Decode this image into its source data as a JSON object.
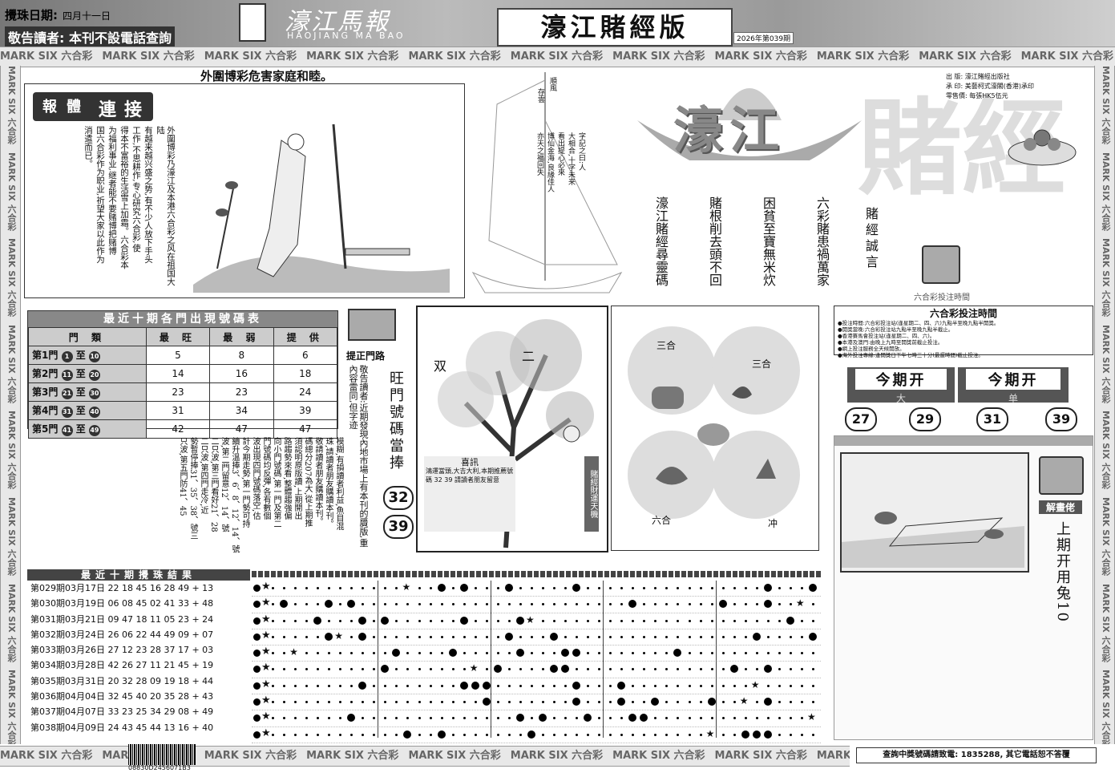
{
  "header": {
    "date_label": "攪珠日期:",
    "date_value": "四月十一日",
    "notice": "敬告讀者: 本刊不設電話查詢",
    "logo_cn": "濠江馬報",
    "logo_en": "HAOJIANG MA BAO",
    "edition": "濠江賭經版",
    "issue": "2026年第039期"
  },
  "band_text": "MARK SIX 六合彩",
  "left_article": {
    "banner": "外圍博彩危害家庭和睦。",
    "tags": [
      "報",
      "體",
      "連",
      "接"
    ],
    "columns": [
      "外圍博彩乃濠江及本港六合彩之风在祖国大陆",
      "有越来越兴盛之势,有不少人放下手头",
      "工作,不思耕作,专心研究六合彩,使",
      "得本不富裕的生活雪上加霜。六合彩本",
      "为福利事业,继者能不要赌博把赌博",
      "国六合彩作为职业,祈望大家以此作为",
      "消遣而已。"
    ]
  },
  "ship": {
    "sail_left": "順風",
    "sail_right": "存雲",
    "poem": [
      "字記之曰:人",
      "大相合,十字未来",
      "看出提心必來",
      "博仙金海,良緣佳人",
      "亦天之福回失"
    ]
  },
  "gamble_title": {
    "big1": "濠江",
    "big2": "賭經",
    "vertical_label": "賭經誠言",
    "verses": [
      "六彩賭患禍萬家",
      "困貧至寶無米炊",
      "賭根削去頭不回",
      "濠江賭經尋靈碼"
    ]
  },
  "publisher": {
    "lines": [
      "出 版: 濠江賭經出版社",
      "承 印: 美藝柯式濠閣(香港)承印",
      "零售價: 每張HK5伍元"
    ]
  },
  "door_table": {
    "title": "最近十期各門出現號碼表",
    "headers": [
      "門 類",
      "最 旺",
      "最 弱",
      "提 供"
    ],
    "rows": [
      {
        "label": "第1門",
        "from": "1",
        "to": "10",
        "max": "5",
        "min": "8",
        "offer": "6"
      },
      {
        "label": "第2門",
        "from": "11",
        "to": "20",
        "max": "14",
        "min": "16",
        "offer": "18"
      },
      {
        "label": "第3門",
        "from": "21",
        "to": "30",
        "max": "23",
        "min": "23",
        "offer": "24"
      },
      {
        "label": "第4門",
        "from": "31",
        "to": "40",
        "max": "31",
        "min": "34",
        "offer": "39"
      },
      {
        "label": "第5門",
        "from": "41",
        "to": "49",
        "max": "42",
        "min": "47",
        "offer": "47"
      }
    ],
    "to_word": "至"
  },
  "door_side": {
    "icon_label": "提正門路",
    "notice": "敬告讀者:近期發現內地市場上有本刊的贗版,重內容雷同,但字迹"
  },
  "door_text": {
    "cols": [
      "模糊,有損讀者利益,魚目混",
      "珠,請讀者朋友購讀本刊。",
      "敬請讀者朋友購讀本刊。",
      "碼總分207為大,從上期推",
      "須認明原版讀,上期開出",
      "路趨勢來看,整體趨強偏",
      "向小門號碼,第一門及第二",
      "門號碼均反彈,各有數個",
      "波出現四門號碼落空,估",
      "計今期走勢,第一門勢可持",
      "續升溫捧3、6、8、12、14、號",
      "波,第二門留意12、14、號",
      "二只波,第三門看好21、28",
      "二只波,第四門走冷,近",
      "勢暫停捧31、35、38、號三",
      "只波,第五門防41、45"
    ]
  },
  "tree": {
    "labels": [
      "二",
      "双"
    ],
    "box_title": "喜訊",
    "box_text": "鴻運當頭,大吉大利,本期推薦號碼 32 39 請讀者朋友留意",
    "side_tag": "賭經財運天機"
  },
  "wang": {
    "title": "旺門號碼當捧",
    "numbers": [
      "32",
      "39"
    ]
  },
  "zodiac": {
    "labels": [
      "三合",
      "三合",
      "六合",
      "冲"
    ]
  },
  "betting": {
    "icon_caption": "六合彩投注時間",
    "title": "六合彩投注時間",
    "lines": [
      "●投注時間:六合彩投注站(逢星期二、四、六)九點半至晚九點半開獎。",
      "●開獎當晚:六合彩投注站九點半至晚九點半截止。",
      "●香港賽馬會投注站(逢星期二、四、六)。",
      "●本港及澳門:由晚上九時至開獎前截止投注。",
      "●網上投注服務全天候開放。",
      "●海外投注專線:逢開獎日下午七時三十分(最遲時間)截止投注。"
    ],
    "open1": "今期开",
    "open1_val": "大",
    "open2": "今期开",
    "open2_val": "单",
    "balls": [
      "27",
      "29",
      "31",
      "39"
    ]
  },
  "riddle": {
    "label": "解畫佬",
    "text": "上期开用兔10"
  },
  "results": {
    "title": "最近十期攪珠結果",
    "rows": [
      "第029期03月17日 22 18 45 16 28 49 + 13",
      "第030期03月19日 06 08 45 02 41 33 + 48",
      "第031期03月21日 09 47 18 11 05 23 + 24",
      "第032期03月24日 26 06 22 44 49 09 + 07",
      "第033期03月26日 27 12 23 28 37 17 + 03",
      "第034期03月28日 42 26 27 11 21 45 + 19",
      "第035期03月31日 20 32 28 09 19 18 + 44",
      "第036期04月04日 32 45 40 20 35 28 + 43",
      "第037期04月07日 33 23 25 34 29 08 + 49",
      "第038期04月09日 24 43 45 44 13 16 + 40"
    ],
    "grid_numbers": [
      [
        22,
        18,
        45,
        16,
        28,
        49,
        13
      ],
      [
        6,
        8,
        45,
        2,
        41,
        33,
        48
      ],
      [
        9,
        47,
        18,
        11,
        5,
        23,
        24
      ],
      [
        26,
        6,
        22,
        44,
        49,
        9,
        7
      ],
      [
        27,
        12,
        23,
        28,
        37,
        17,
        3
      ],
      [
        42,
        26,
        27,
        11,
        21,
        45,
        19
      ],
      [
        20,
        32,
        28,
        9,
        19,
        18,
        44
      ],
      [
        32,
        45,
        40,
        20,
        35,
        28,
        43
      ],
      [
        33,
        23,
        25,
        34,
        29,
        8,
        49
      ],
      [
        24,
        43,
        45,
        44,
        13,
        16,
        40
      ]
    ]
  },
  "footer": {
    "barcode": "08830D2456071B3",
    "hotline": "查詢中獎號碼請致電: 1835288, 其它電話恕不答覆"
  },
  "colors": {
    "dark": "#222222",
    "gray": "#cccccc",
    "band": "#e8e8e8"
  }
}
